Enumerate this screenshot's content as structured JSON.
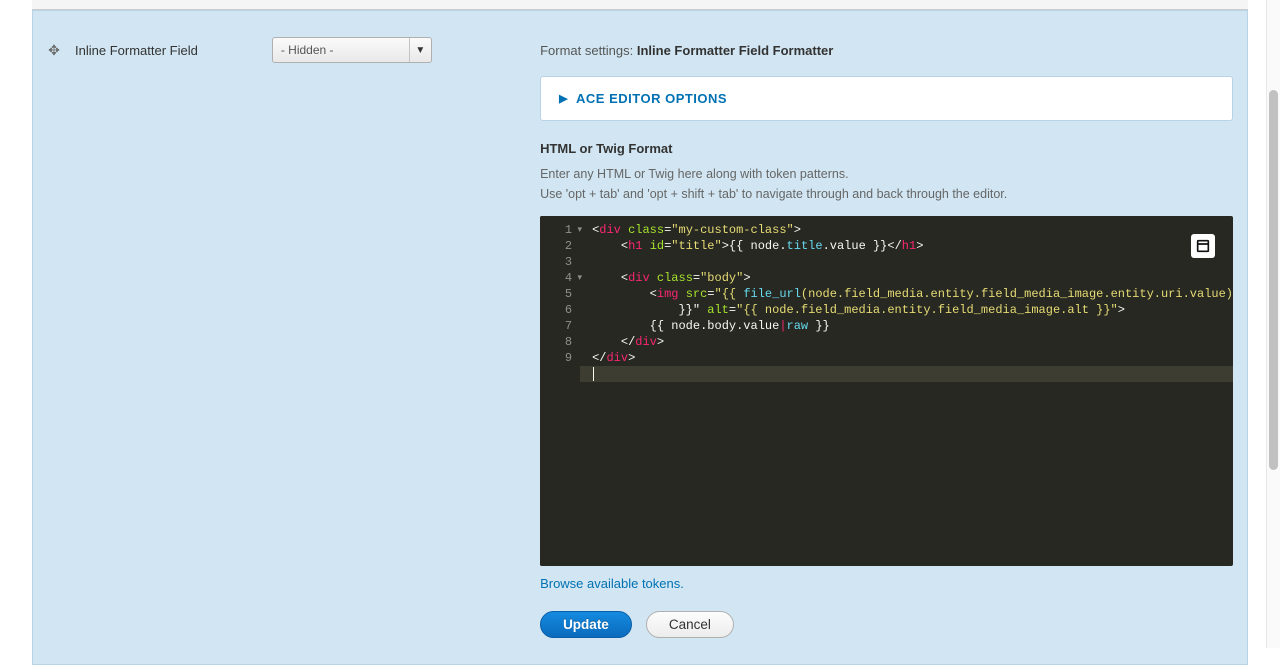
{
  "left": {
    "field_label": "Inline Formatter Field",
    "select_value": "- Hidden -"
  },
  "right": {
    "format_settings_prefix": "Format settings: ",
    "format_settings_name": "Inline Formatter Field Formatter",
    "accordion_title": "ACE EDITOR OPTIONS",
    "section_label": "HTML or Twig Format",
    "hint1": "Enter any HTML or Twig here along with token patterns.",
    "hint2": "Use 'opt + tab' and 'opt + shift + tab' to navigate through and back through the editor.",
    "tokens_link": "Browse available tokens.",
    "update_label": "Update",
    "cancel_label": "Cancel"
  },
  "editor": {
    "line_numbers": [
      "1",
      "2",
      "3",
      "4",
      "5",
      "6",
      "7",
      "8",
      "9"
    ],
    "fold_lines": [
      1,
      4
    ],
    "active_line_index": 9,
    "code_lines_plain": [
      "<div class=\"my-custom-class\">",
      "    <h1 id=\"title\">{{ node.title.value }}</h1>",
      "",
      "    <div class=\"body\">",
      "        <img src=\"{{ file_url(node.field_media.entity.field_media_image.entity.uri.value) }}\" alt=\"{{ node.field_media.entity.field_media_image.alt }}\">",
      "        {{ node.body.value|raw }}",
      "    </div>",
      "</div>",
      ""
    ]
  }
}
